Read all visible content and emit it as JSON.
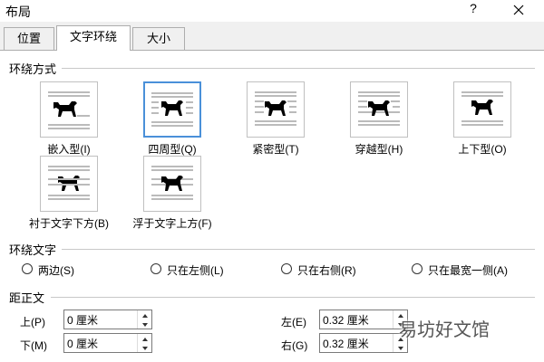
{
  "window": {
    "title": "布局",
    "help": "?"
  },
  "tabs": [
    {
      "label": "位置"
    },
    {
      "label": "文字环绕"
    },
    {
      "label": "大小"
    }
  ],
  "wrap_style": {
    "heading": "环绕方式",
    "options": [
      {
        "label": "嵌入型(I)"
      },
      {
        "label": "四周型(Q)"
      },
      {
        "label": "紧密型(T)"
      },
      {
        "label": "穿越型(H)"
      },
      {
        "label": "上下型(O)"
      },
      {
        "label": "衬于文字下方(B)"
      },
      {
        "label": "浮于文字上方(F)"
      }
    ],
    "selected": "四周型(Q)"
  },
  "wrap_text": {
    "heading": "环绕文字",
    "options": [
      {
        "label": "两边(S)"
      },
      {
        "label": "只在左侧(L)"
      },
      {
        "label": "只在右侧(R)"
      },
      {
        "label": "只在最宽一侧(A)"
      }
    ]
  },
  "distance": {
    "heading": "距正文",
    "top": {
      "label": "上(P)",
      "value": "0 厘米"
    },
    "bottom": {
      "label": "下(M)",
      "value": "0 厘米"
    },
    "left": {
      "label": "左(E)",
      "value": "0.32 厘米"
    },
    "right": {
      "label": "右(G)",
      "value": "0.32 厘米"
    }
  },
  "watermark": "易坊好文馆",
  "colors": {
    "selected_border": "#4a90d9"
  }
}
